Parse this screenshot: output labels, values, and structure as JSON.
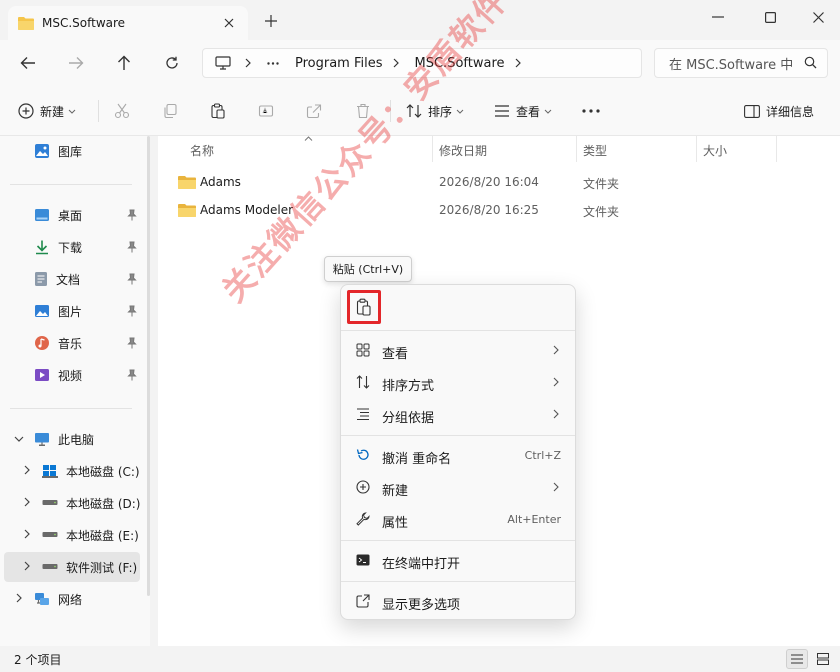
{
  "tab": {
    "title": "MSC.Software"
  },
  "address": {
    "segments": [
      "Program Files",
      "MSC.Software"
    ]
  },
  "search": {
    "placeholder": "在 MSC.Software 中"
  },
  "toolbar": {
    "new_label": "新建",
    "sort_label": "排序",
    "view_label": "查看",
    "details_label": "详细信息"
  },
  "sidebar": {
    "gallery": "图库",
    "quick": [
      {
        "label": "桌面"
      },
      {
        "label": "下载"
      },
      {
        "label": "文档"
      },
      {
        "label": "图片"
      },
      {
        "label": "音乐"
      },
      {
        "label": "视频"
      }
    ],
    "this_pc": "此电脑",
    "drives": [
      {
        "label": "本地磁盘 (C:)"
      },
      {
        "label": "本地磁盘 (D:)"
      },
      {
        "label": "本地磁盘 (E:)"
      },
      {
        "label": "软件测试 (F:)"
      }
    ],
    "network": "网络"
  },
  "columns": {
    "name": "名称",
    "modified": "修改日期",
    "type": "类型",
    "size": "大小"
  },
  "files": [
    {
      "name": "Adams",
      "modified": "2026/8/20 16:04",
      "type": "文件夹"
    },
    {
      "name": "Adams Modeler",
      "modified": "2026/8/20 16:25",
      "type": "文件夹"
    }
  ],
  "status": {
    "text": "2 个项目"
  },
  "tooltip": {
    "text": "粘贴 (Ctrl+V)"
  },
  "context_menu": {
    "view": "查看",
    "sort_by": "排序方式",
    "group_by": "分组依据",
    "undo": "撤消 重命名",
    "undo_shortcut": "Ctrl+Z",
    "new": "新建",
    "properties": "属性",
    "properties_shortcut": "Alt+Enter",
    "open_terminal": "在终端中打开",
    "more_options": "显示更多选项"
  },
  "watermark": {
    "text": "关注微信公众号：安盾软件管家"
  },
  "colors": {
    "highlight_red": "#e3262a",
    "folder_yellow": "#f5c54a",
    "accent_blue": "#0067c0"
  }
}
